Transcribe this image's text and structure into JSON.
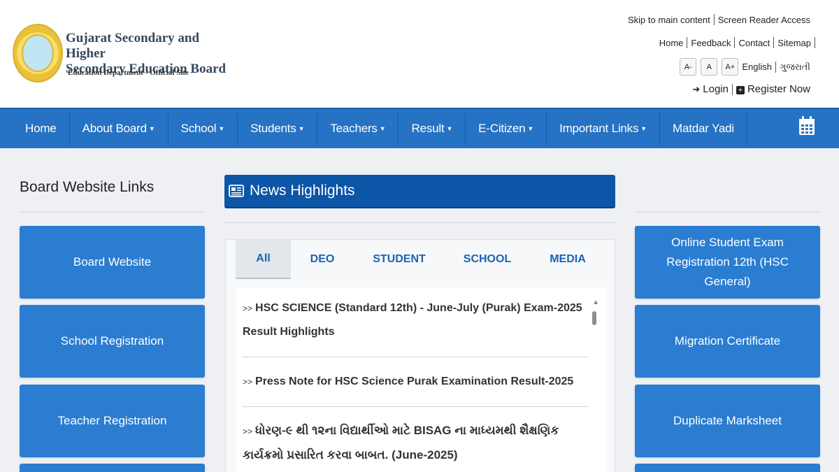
{
  "header": {
    "title_line1": "Gujarat Secondary and Higher",
    "title_line2": "Secondary Education Board",
    "subtitle": "Education Department - Official Site",
    "skip_link": "Skip to main content",
    "screen_reader": "Screen Reader Access",
    "links": [
      "Home",
      "Feedback",
      "Contact",
      "Sitemap"
    ],
    "font_buttons": [
      "A-",
      "A",
      "A+"
    ],
    "lang_english": "English",
    "lang_gujarati": "ગુજરાતી",
    "login": "Login",
    "register": "Register Now"
  },
  "nav": {
    "items": [
      "Home",
      "About Board",
      "School",
      "Students",
      "Teachers",
      "Result",
      "E-Citizen",
      "Important Links",
      "Matdar Yadi"
    ],
    "accent": "#2672c4"
  },
  "left": {
    "title": "Board Website Links",
    "tiles": [
      "Board Website",
      "School Registration",
      "Teacher Registration"
    ]
  },
  "news": {
    "title": "News Highlights",
    "tabs": [
      "All",
      "DEO",
      "STUDENT",
      "SCHOOL",
      "MEDIA"
    ],
    "arrow": ">>",
    "items": [
      "HSC SCIENCE (Standard 12th) - June-July (Purak) Exam-2025 Result Highlights",
      "Press Note for HSC Science Purak Examination Result-2025",
      "ધોરણ-૯ થી ૧૨ના વિદ્યાર્થીઓ માટે BISAG ના માધ્યમથી શૈક્ષણિક કાર્યક્રમો પ્રસારિત કરવા બાબત. (June-2025)"
    ]
  },
  "right": {
    "tiles": [
      "Online Student Exam Registration 12th (HSC General)",
      "Migration Certificate",
      "Duplicate Marksheet"
    ]
  }
}
